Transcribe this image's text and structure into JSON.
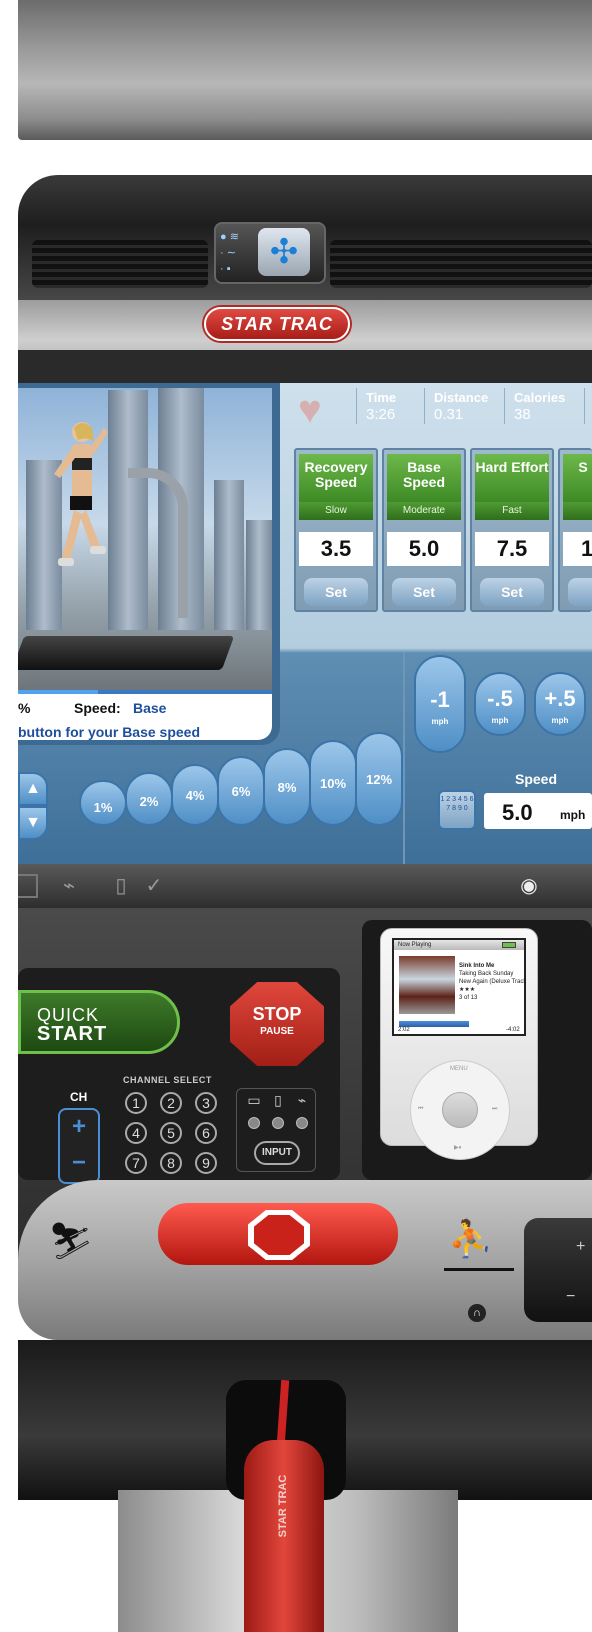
{
  "brand": {
    "logo_text": "STAR TRAC"
  },
  "stats": {
    "time_label": "Time",
    "time_value": "3:26",
    "distance_label": "Distance",
    "distance_value": "0.31",
    "calories_label": "Calories",
    "calories_value": "38"
  },
  "presets": [
    {
      "title": "Recovery Speed",
      "subtitle": "Slow",
      "value": "3.5",
      "set_label": "Set"
    },
    {
      "title": "Base Speed",
      "subtitle": "Moderate",
      "value": "5.0",
      "set_label": "Set"
    },
    {
      "title": "Hard Effort",
      "subtitle": "Fast",
      "value": "7.5",
      "set_label": "Set"
    },
    {
      "title": "S",
      "subtitle": "",
      "value": "1",
      "set_label": ""
    }
  ],
  "video_caption": {
    "pct": "%",
    "speed_label": "Speed:",
    "speed_value": "Base",
    "hint": "button for your Base speed"
  },
  "incline_buttons": [
    "1%",
    "2%",
    "4%",
    "6%",
    "8%",
    "10%",
    "12%"
  ],
  "speed_buttons": [
    {
      "label": "-1",
      "unit": "mph"
    },
    {
      "label": "-.5",
      "unit": "mph"
    },
    {
      "label": "+.5",
      "unit": "mph"
    }
  ],
  "speed_readout": {
    "title": "Speed",
    "value": "5.0",
    "unit": "mph"
  },
  "keypad": "1 2 3 4 5 6 7 8 9 0",
  "console": {
    "quick_label": "QUICK",
    "start_label": "START",
    "stop_label": "STOP",
    "pause_label": "PAUSE",
    "channel_select": "CHANNEL SELECT",
    "ch_label": "CH",
    "channel_numbers": [
      "1",
      "2",
      "3",
      "4",
      "5",
      "6",
      "7",
      "8",
      "9"
    ],
    "input_label": "INPUT"
  },
  "ipod": {
    "header": "Now Playing",
    "track": "Sink Into Me",
    "artist": "Taking Back Sunday",
    "album": "New Again (Deluxe Track",
    "rating": "★★★",
    "count": "3 of 13",
    "elapsed": "2:02",
    "remaining": "-4:02",
    "menu": "MENU",
    "prev": "⏮",
    "next": "⏭",
    "play": "▶⏸"
  },
  "key_label": "STAR TRAC"
}
